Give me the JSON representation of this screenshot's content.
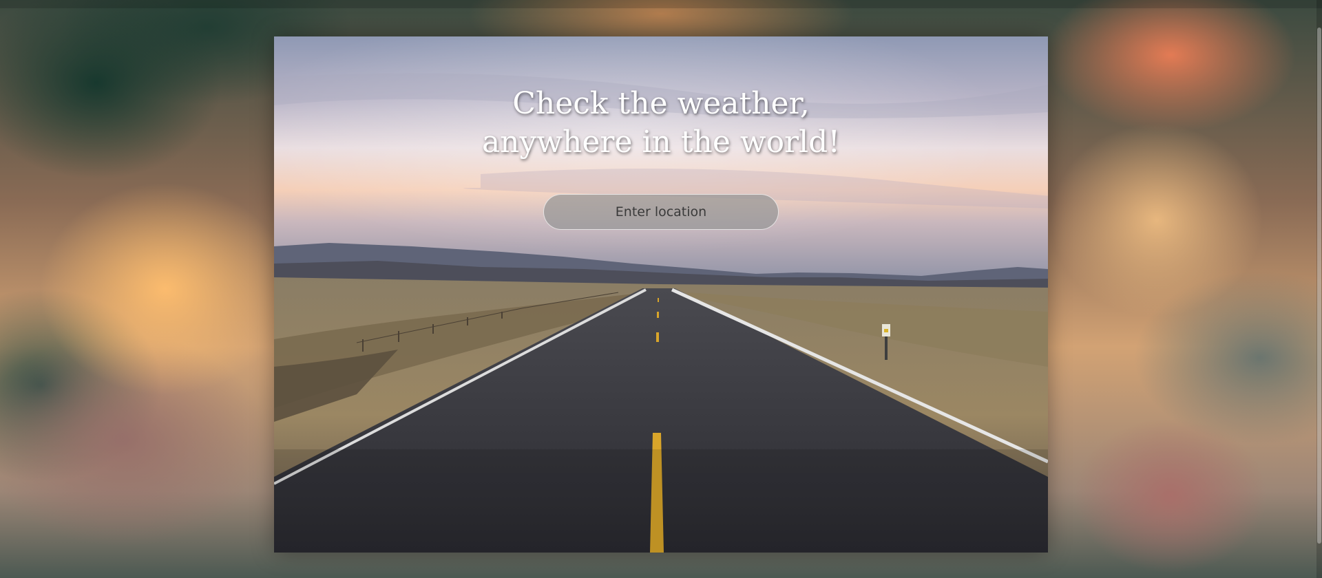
{
  "hero": {
    "line1": "Check the weather,",
    "line2": "anywhere in the world!"
  },
  "search": {
    "placeholder": "Enter location",
    "value": ""
  },
  "colors": {
    "heading_text": "#ffffff",
    "input_background": "#969696",
    "road_line": "#d9a52a"
  },
  "background": {
    "description_icon": "cloudy-sunset-background"
  }
}
